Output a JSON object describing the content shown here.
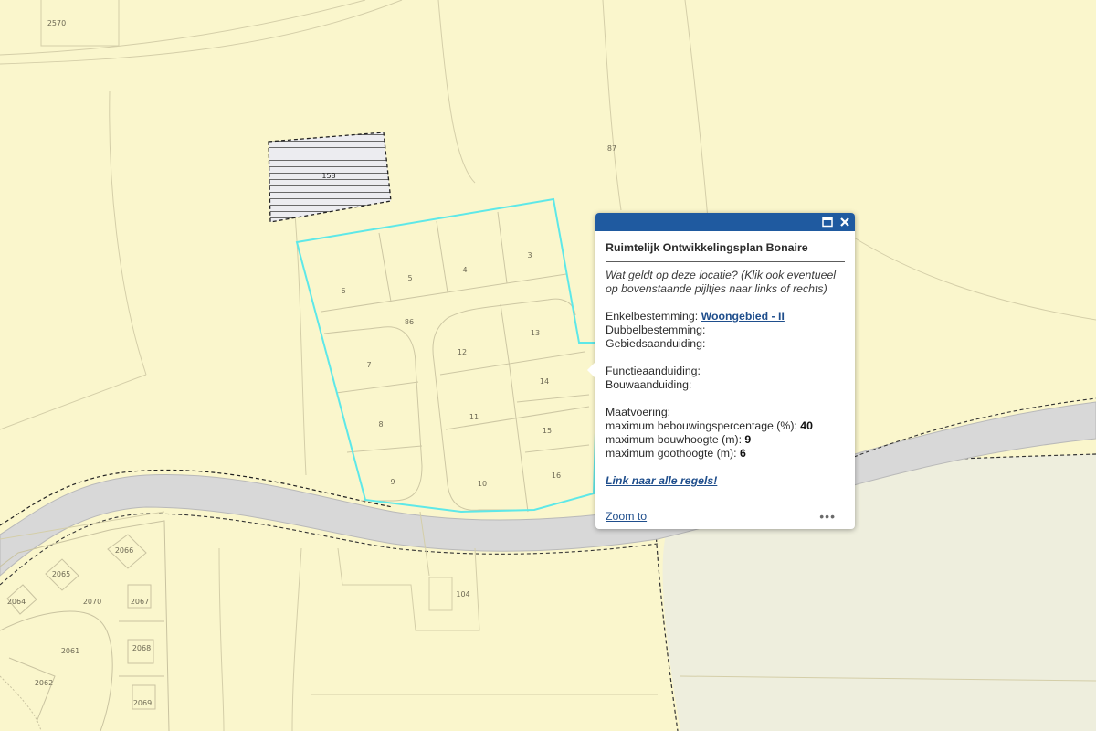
{
  "map": {
    "parcel_labels": [
      "2570",
      "87",
      "158",
      "6",
      "5",
      "4",
      "3",
      "86",
      "13",
      "12",
      "7",
      "14",
      "8",
      "11",
      "15",
      "9",
      "10",
      "16",
      "2066",
      "2065",
      "2064",
      "2070",
      "2067",
      "2061",
      "2068",
      "2062",
      "2069",
      "104"
    ],
    "colors": {
      "background": "#faf6cc",
      "zone_green": "#eeeedd",
      "road": "#d7d7d7",
      "plan_outline": "#5de6e6",
      "parcel_line": "#cfc9a8",
      "hatched_fill": "#e9e9ee"
    }
  },
  "popup": {
    "title": "Ruimtelijk Ontwikkelingsplan Bonaire",
    "question": "Wat geldt op deze locatie? (Klik ook eventueel op bovenstaande pijltjes naar links of rechts)",
    "enkel_label": "Enkelbestemming:",
    "enkel_value": "Woongebied - II",
    "dubbel_label": "Dubbelbestemming:",
    "gebied_label": "Gebiedsaanduiding:",
    "functie_label": "Functieaanduiding:",
    "bouw_label": "Bouwaanduiding:",
    "maat_label": "Maatvoering:",
    "max_bebouwing_label": "maximum bebouwingspercentage (%):",
    "max_bebouwing_value": "40",
    "max_bouwhoogte_label": "maximum bouwhoogte (m):",
    "max_bouwhoogte_value": "9",
    "max_goothoogte_label": "maximum goothoogte (m):",
    "max_goothoogte_value": "6",
    "rules_link": "Link naar alle regels!",
    "zoom_label": "Zoom to",
    "more_label": "•••",
    "header_color": "#1f5aa0"
  }
}
